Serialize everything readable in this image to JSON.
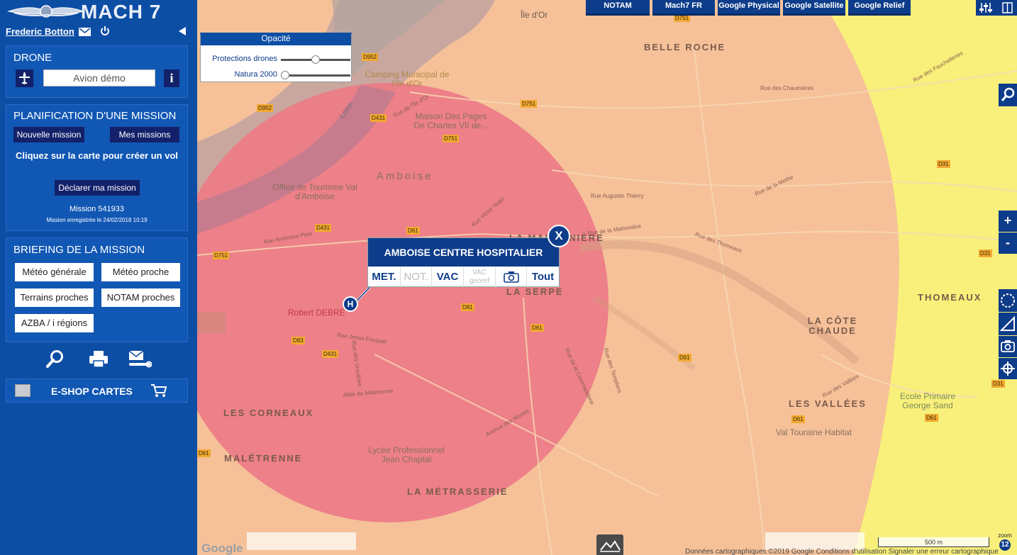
{
  "app": {
    "logo_text": "MACH 7"
  },
  "user": {
    "name": "Frederic Botton"
  },
  "drone": {
    "title": "DRONE",
    "aircraft": "Avion démo",
    "info_label": "i"
  },
  "planning": {
    "title": "PLANIFICATION D'UNE MISSION",
    "new_mission": "Nouvelle mission",
    "my_missions": "Mes missions",
    "hint": "Cliquez sur la carte pour créer un vol",
    "declare": "Déclarer ma mission",
    "mission_id": "Mission 541933",
    "mission_saved": "Mission enregistrée le 24/02/2018 10:19"
  },
  "briefing": {
    "title": "BRIEFING DE LA MISSION",
    "meteo_generale": "Météo générale",
    "meteo_proche": "Météo proche",
    "terrains_proches": "Terrains proches",
    "notam_proches": "NOTAM proches",
    "azba": "AZBA / i régions"
  },
  "eshop": {
    "label": "E-SHOP CARTES"
  },
  "opacity": {
    "title": "Opacité",
    "rows": [
      {
        "label": "Protections drones",
        "value": 0.5
      },
      {
        "label": "Natura 2000",
        "value": 0.0
      }
    ]
  },
  "map_tabs": [
    "NOTAM",
    "Mach7 FR",
    "Google Physical",
    "Google Satellite",
    "Google Relief"
  ],
  "popup": {
    "title": "AMBOISE CENTRE HOSPITALIER",
    "close": "X",
    "marker": "H",
    "cells": [
      {
        "label": "MET.",
        "enabled": true
      },
      {
        "label": "NOT.",
        "enabled": false
      },
      {
        "label": "VAC",
        "enabled": true
      },
      {
        "label": "VAC georef",
        "enabled": false
      },
      {
        "label": "camera-icon",
        "enabled": true
      },
      {
        "label": "Tout",
        "enabled": true
      }
    ]
  },
  "zoom_controls": {
    "plus": "+",
    "minus": "-"
  },
  "map_labels": {
    "ile_dor": "Île d'Or",
    "belle_roche": "BELLE ROCHE",
    "amboise": "Amboise",
    "la_malonniere": "LA MALONNIÈRE",
    "la_serpe": "LA SERPE",
    "thomeaux": "THOMEAUX",
    "la_cote_chaude": "LA CÔTE CHAUDE",
    "les_corneaux": "LES CORNEAUX",
    "les_vallees": "LES VALLÉES",
    "maletrenne": "MALÉTRENNE",
    "la_metrasserie": "LA MÉTRASSERIE",
    "loire": "Loire"
  },
  "pois": {
    "camping": "Camping Municipal de l'Ile d'Or",
    "maison_pages": "Maison Des Pages De Charles VII de...",
    "office_tourisme": "Office de Tourisme Val d'Amboise",
    "robert_debre": "Robert DEBRÉ",
    "lycee": "Lycée Professionnel Jean Chaptal",
    "ecole": "Ecole Primaire George Sand",
    "val_touraine": "Val Touraine Habitat"
  },
  "road_badges": [
    "D952",
    "D751",
    "D952",
    "D431",
    "D751",
    "D751",
    "D431",
    "D751",
    "D61",
    "D81",
    "D61",
    "D83",
    "D431",
    "D61",
    "D61",
    "D61",
    "D31",
    "D31",
    "D31",
    "D61"
  ],
  "streets": {
    "r_chaumieres": "Rue des Chaumières",
    "r_fauchelleries": "Rue des Fauchelleries",
    "r_victor_hugo": "Rue Victor Hugo",
    "r_malonniere": "Rue de la Malonnière",
    "r_thomeaux": "Rue des Thomeaux",
    "r_augustin": "Rue Augustin Thierry",
    "r_mothe": "Rue de la Mothe",
    "r_jehan": "Rue Jehan Fouquet",
    "r_ursulines": "Rue des Ursulines",
    "allee_maletrenne": "Allée de Maletrenne",
    "av_montils": "Avenue des Montils",
    "r_templiers": "Rue des Templiers",
    "r_vallees": "Rue des Vallées",
    "r_ambroise": "Rue Ambroise Paré",
    "r_commanderie": "Rue de la Commanderie",
    "r_ile_dor": "Rue de l'Île d'Or"
  },
  "bottom": {
    "google": "Google",
    "credits": "Données cartographiques ©2019 Google   Conditions d'utilisation   Signaler une erreur cartographique",
    "scale": "500 m",
    "zoom_label": "zoom",
    "zoom_value": "12"
  },
  "colors": {
    "sidebar": "#0d4ea5",
    "panel": "#1157b4",
    "dark_btn": "#12216a",
    "zone_orange": "#f6c199",
    "zone_red": "#ec7c87",
    "zone_yellow": "#f8f07a"
  }
}
